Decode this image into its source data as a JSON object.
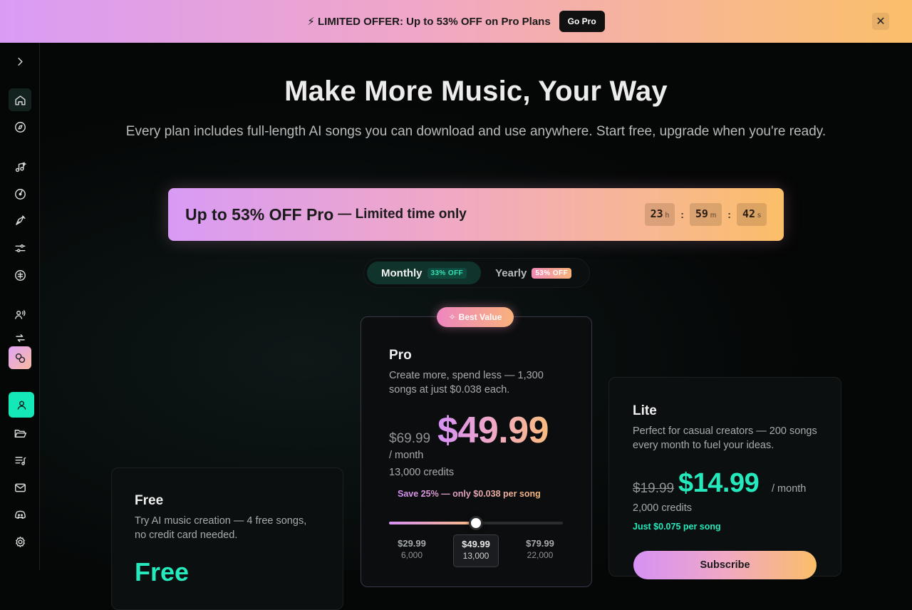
{
  "promo": {
    "text": "⚡ LIMITED OFFER: Up to 53% OFF on Pro Plans",
    "cta": "Go Pro",
    "close": "✕"
  },
  "sidebar": {
    "items": [
      {
        "name": "expand",
        "icon": "chevron-right-icon"
      },
      {
        "name": "home",
        "icon": "home-icon",
        "active": true
      },
      {
        "name": "explore",
        "icon": "compass-icon"
      },
      {
        "name": "create-music",
        "icon": "music-add-icon"
      },
      {
        "name": "library",
        "icon": "disc-icon"
      },
      {
        "name": "studio",
        "icon": "pen-nib-icon"
      },
      {
        "name": "tools",
        "icon": "sliders-icon"
      },
      {
        "name": "pricing",
        "icon": "currency-icon"
      },
      {
        "name": "voice",
        "icon": "voice-icon"
      },
      {
        "name": "remix",
        "icon": "loop-icon"
      },
      {
        "name": "affiliate",
        "icon": "coins-icon"
      },
      {
        "name": "account",
        "icon": "user-icon"
      },
      {
        "name": "folders",
        "icon": "folder-open-icon"
      },
      {
        "name": "playlists",
        "icon": "playlist-icon"
      },
      {
        "name": "messages",
        "icon": "mail-icon"
      },
      {
        "name": "discord",
        "icon": "discord-icon"
      },
      {
        "name": "settings",
        "icon": "gear-icon"
      }
    ]
  },
  "hero": {
    "title": "Make More Music, Your Way",
    "subtitle": "Every plan includes full-length AI songs you can download and use anywhere. Start free, upgrade when you're ready."
  },
  "offer": {
    "headline": "Up to 53% OFF Pro",
    "tail": "— Limited time only",
    "countdown": {
      "hours": "23",
      "minutes": "59",
      "seconds": "42",
      "h": "h",
      "m": "m",
      "s": "s",
      "sep": ":"
    }
  },
  "billing_toggle": {
    "monthly_label": "Monthly",
    "monthly_badge": "33% OFF",
    "yearly_label": "Yearly",
    "yearly_badge": "53% OFF",
    "selected": "Monthly"
  },
  "plans": {
    "free": {
      "title": "Free",
      "desc": "Try AI music creation — 4 free songs, no credit card needed.",
      "price": "Free"
    },
    "pro": {
      "badge": "Best Value",
      "title": "Pro",
      "desc": "Create more, spend less — 1,300 songs at just $0.038 each.",
      "old_price": "$69.99",
      "price": "$49.99",
      "per": "/ month",
      "credits": "13,000 credits",
      "save": "Save 25% — only $0.038 per song",
      "slider_fraction": 0.5,
      "tiers": [
        {
          "price": "$29.99",
          "credits": "6,000"
        },
        {
          "price": "$49.99",
          "credits": "13,000",
          "active": true
        },
        {
          "price": "$79.99",
          "credits": "22,000"
        }
      ]
    },
    "lite": {
      "title": "Lite",
      "desc": "Perfect for casual creators — 200 songs every month to fuel your ideas.",
      "old_price": "$19.99",
      "price": "$14.99",
      "per": "/ month",
      "credits": "2,000 credits",
      "save": "Just $0.075 per song",
      "cta": "Subscribe"
    }
  },
  "colors": {
    "accent_teal": "#24e9bc",
    "gradient_start": "#d691f5",
    "gradient_end": "#fbbe68",
    "background": "#050606"
  }
}
